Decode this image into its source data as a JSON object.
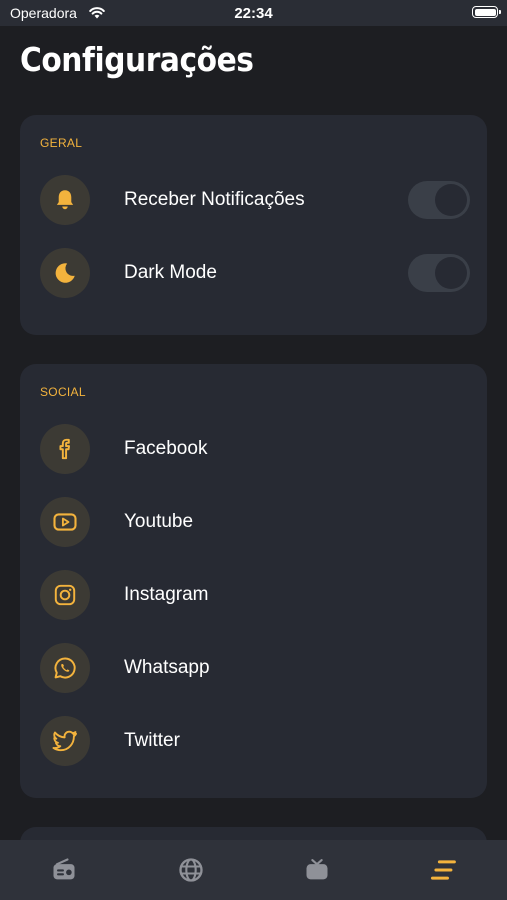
{
  "status_bar": {
    "carrier": "Operadora",
    "time": "22:34"
  },
  "page": {
    "title": "Configurações"
  },
  "sections": {
    "geral": {
      "label": "GERAL",
      "items": [
        {
          "label": "Receber Notificações",
          "icon": "bell-icon",
          "toggle": false
        },
        {
          "label": "Dark Mode",
          "icon": "moon-icon",
          "toggle": false
        }
      ]
    },
    "social": {
      "label": "SOCIAL",
      "items": [
        {
          "label": "Facebook",
          "icon": "facebook-icon"
        },
        {
          "label": "Youtube",
          "icon": "youtube-icon"
        },
        {
          "label": "Instagram",
          "icon": "instagram-icon"
        },
        {
          "label": "Whatsapp",
          "icon": "whatsapp-icon"
        },
        {
          "label": "Twitter",
          "icon": "twitter-icon"
        }
      ]
    }
  },
  "tab_bar": {
    "tabs": [
      {
        "icon": "radio-icon",
        "active": false
      },
      {
        "icon": "globe-icon",
        "active": false
      },
      {
        "icon": "tv-icon",
        "active": false
      },
      {
        "icon": "menu-icon",
        "active": true
      }
    ]
  },
  "colors": {
    "accent": "#f3b33d",
    "background": "#1d1e22",
    "card": "#272a33",
    "tab_inactive": "#8f9198"
  }
}
